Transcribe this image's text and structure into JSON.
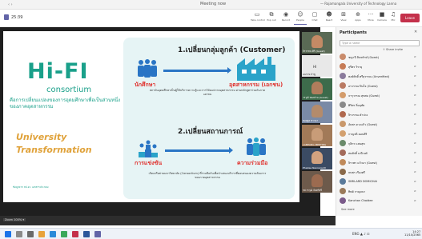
{
  "window": {
    "title": "Meeting now",
    "user": "— Rajamangala University of Technology Lanna"
  },
  "toolbar": {
    "timer": "25:39",
    "buttons": [
      {
        "label": "Take control",
        "icon": "screen-icon"
      },
      {
        "label": "Pop out",
        "icon": "popout-icon"
      },
      {
        "label": "Record",
        "icon": "record-icon"
      },
      {
        "label": "People",
        "icon": "people-icon"
      },
      {
        "label": "Chat",
        "icon": "chat-icon"
      },
      {
        "label": "React",
        "icon": "react-icon"
      },
      {
        "label": "View",
        "icon": "view-icon"
      },
      {
        "label": "Apps",
        "icon": "apps-icon"
      },
      {
        "label": "More",
        "icon": "more-icon"
      },
      {
        "label": "Camera",
        "icon": "camera-icon"
      },
      {
        "label": "Mic",
        "icon": "mic-icon"
      },
      {
        "label": "Share",
        "icon": "share-icon"
      }
    ],
    "leave": "Leave"
  },
  "slide": {
    "hifi": "Hi-FI",
    "consortium": "consortium",
    "desc": "คือการเปลี่ยนแปลงของการอุดมศึกษาเพื่อเป็นส่วนหนึ่งของภาคอุตสาหกรรม",
    "ut_line1": "University",
    "ut_line2": "Transformation",
    "footer": "ข้อมูลจาก สป.อว. เอกสารประกอบ",
    "h1": "1.เปลี่ยนกลุ่มลูกค้า (Customer)",
    "student": "นักศึกษา",
    "industry": "อุตสาหกรรม (เอกชน)",
    "desc1": "สถาบันอุดมศึกษาเป็นผู้ให้บริการความรู้และการวิจัยแก่ภาคอุตสาหกรรม ผ่านหลักสูตรร่วมกับภาคเอกชน",
    "h2": "2.เปลี่ยนสถานการณ์",
    "compete": "การแข่งขัน",
    "cooperate": "ความร่วมมือ",
    "desc2": "เกิดเครือข่ายมหาวิทยาลัย (Consortium) ที่ร่วมมือกันเพื่อนำเสนอบริการที่ตอบสนองความต้องการของภาคอุตสาหกรรม"
  },
  "videos": [
    {
      "name": "จิรวรรณ ศิริ (Guest)",
      "color": "#5a6a55",
      "skin": "#c48a65"
    },
    {
      "name": "อนรรฆ ลำพู",
      "color": "#e8e8e8",
      "skin": "#e8e8e8",
      "initials": "HI"
    },
    {
      "name": "วรวุฒิ ทองปาน (Guest)",
      "color": "#3d6b4b",
      "skin": "#b07d5c"
    },
    {
      "name": "ทองพูล ชาวนา",
      "color": "#7a8aa6",
      "skin": "#b48b6b"
    },
    {
      "name": "LAMPANG MEETING",
      "color": "#a27a58",
      "skin": "#c89c78"
    },
    {
      "name": "Phadee Naonpradit",
      "color": "#3b4b63",
      "skin": "#d2a27f"
    },
    {
      "name": "รศ.วรวุฒิ จันทร์ศรี",
      "color": "#6d5a4b",
      "skin": "#9c6b50"
    }
  ],
  "presenter_tile": {
    "name": "",
    "label": "Presenter"
  },
  "status": {
    "zoom": "Zoom 100% ▾"
  },
  "participants": {
    "title": "Participants",
    "search": "Type a name",
    "share_invite": "Share invite",
    "list": [
      {
        "name": "ชญานี ลินทรักษ์ (Guest)",
        "color": "#c98b6b"
      },
      {
        "name": "สุรีพร วิรายุ",
        "color": "#c67b56"
      },
      {
        "name": "พงษ์ศักดิ์ ศรีสุวรรณ (Unverified)",
        "color": "#8a7a9c"
      },
      {
        "name": "อรวรรณ ปินใจ (Guest)",
        "color": "#b97962"
      },
      {
        "name": "จารุวรรณ สุขสม (Guest)",
        "color": "#d49c6b"
      },
      {
        "name": "ศิริพร ลิ่มอุทัย",
        "color": "#8a8a8a"
      },
      {
        "name": "จิรวรรณ คำปวง",
        "color": "#b0684e"
      },
      {
        "name": "อัมพร ดวงแก้ว (Guest)",
        "color": "#c9986b"
      },
      {
        "name": "กาญจนี ดอนสิริ",
        "color": "#d3a06f"
      },
      {
        "name": "กุลิกร แสนสุข",
        "color": "#6a8a6a"
      },
      {
        "name": "สมศักดิ์ มณีวงศ์",
        "color": "#a36a5a"
      },
      {
        "name": "จิราพร แก้วมา (Guest)",
        "color": "#c08a5a"
      },
      {
        "name": "ธนพร เรืองศรี",
        "color": "#8a6a4a"
      },
      {
        "name": "SIMILARD DOMICHAI",
        "color": "#5a7a9a"
      },
      {
        "name": "ทิพย์ กาญจนา",
        "color": "#9a7a5a"
      },
      {
        "name": "Kanchan Chaidee",
        "color": "#7a5a8a"
      }
    ],
    "see_more": "See more"
  },
  "taskbar": {
    "time": "14:27",
    "date": "11/10/2565",
    "tray": "ENG ▲ ♪ ⊡"
  }
}
